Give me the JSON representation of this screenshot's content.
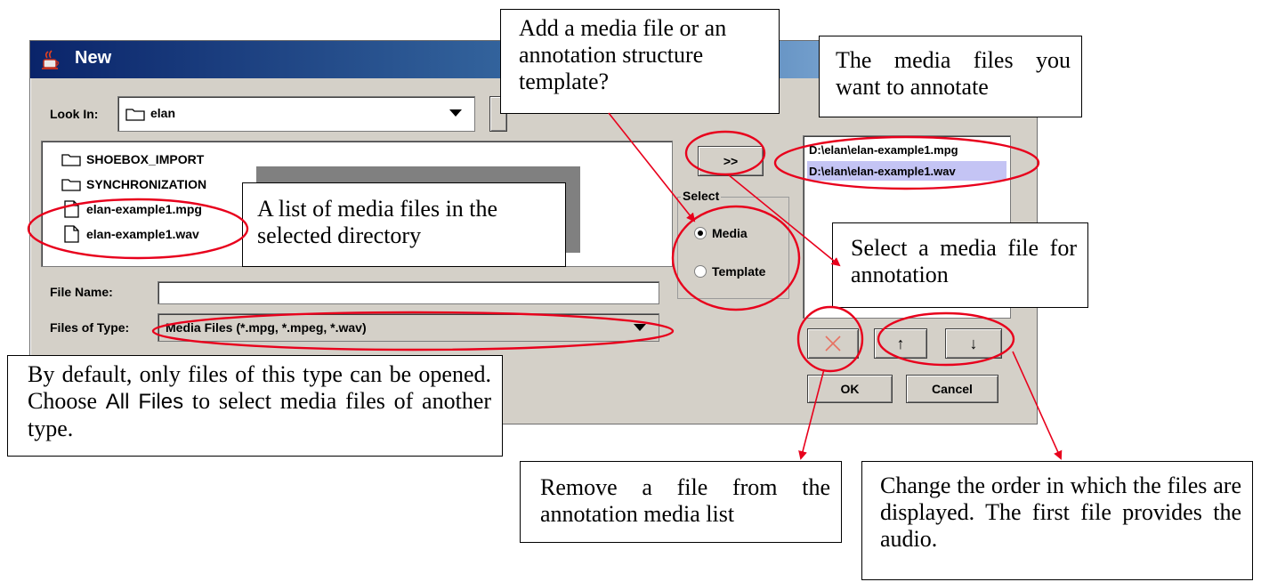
{
  "dialog": {
    "title": "New",
    "look_in_label": "Look In:",
    "look_in_value": "elan",
    "files": [
      {
        "name": "SHOEBOX_IMPORT",
        "kind": "folder"
      },
      {
        "name": "SYNCHRONIZATION",
        "kind": "folder"
      },
      {
        "name": "elan-example1.mpg",
        "kind": "file"
      },
      {
        "name": "elan-example1.wav",
        "kind": "file"
      }
    ],
    "file_name_label": "File Name:",
    "file_name_value": "",
    "files_of_type_label": "Files of Type:",
    "files_of_type_value": "Media Files (*.mpg, *.mpeg, *.wav)",
    "add_button": ">>",
    "select_group_label": "Select",
    "radio_media": "Media",
    "radio_template": "Template",
    "selected_files": [
      "D:\\elan\\elan-example1.mpg",
      "D:\\elan\\elan-example1.wav"
    ],
    "remove_button_icon": "remove-x-icon",
    "up_button": "↑",
    "down_button": "↓",
    "ok_button": "OK",
    "cancel_button": "Cancel"
  },
  "callouts": {
    "add_media": "Add a media file or an annotation structure template?",
    "media_to_annotate": "The media files you want to annotate",
    "list_media": "A list of media files in the selected directory",
    "select_media": "Select a media file for annotation",
    "default_type_prefix": "By default, only files of this type can be opened. Choose",
    "default_type_all": "All Files",
    "default_type_suffix": "to select media files of another type.",
    "remove_file": "Remove a file from the annotation media list",
    "change_order": "Change the order in which the files are displayed. The first file provides the audio."
  },
  "colors": {
    "annotation_red": "#e8001c",
    "dialog_bg": "#d4d0c8",
    "title_bar": "#0a246a",
    "selection": "#c4c4f4"
  }
}
